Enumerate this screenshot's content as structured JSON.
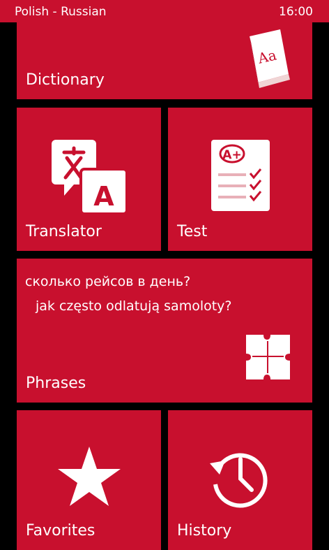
{
  "status_bar": {
    "title": "Polish - Russian",
    "time": "16:00"
  },
  "tiles": {
    "dictionary": {
      "label": "Dictionary",
      "icon": "dictionary-book-icon",
      "icon_text": "Aa"
    },
    "translator": {
      "label": "Translator",
      "icon": "translate-icon",
      "icon_text": "A"
    },
    "test": {
      "label": "Test",
      "icon": "test-checklist-icon",
      "icon_text": "A+"
    },
    "phrases": {
      "label": "Phrases",
      "icon": "puzzle-icon",
      "phrase_ru": "сколько рейсов в день?",
      "phrase_pl": "jak często odlatują samoloty?"
    },
    "favorites": {
      "label": "Favorites",
      "icon": "star-icon"
    },
    "history": {
      "label": "History",
      "icon": "history-clock-icon"
    }
  },
  "colors": {
    "tile": "#c8102e",
    "background": "#000000",
    "text": "#ffffff"
  }
}
